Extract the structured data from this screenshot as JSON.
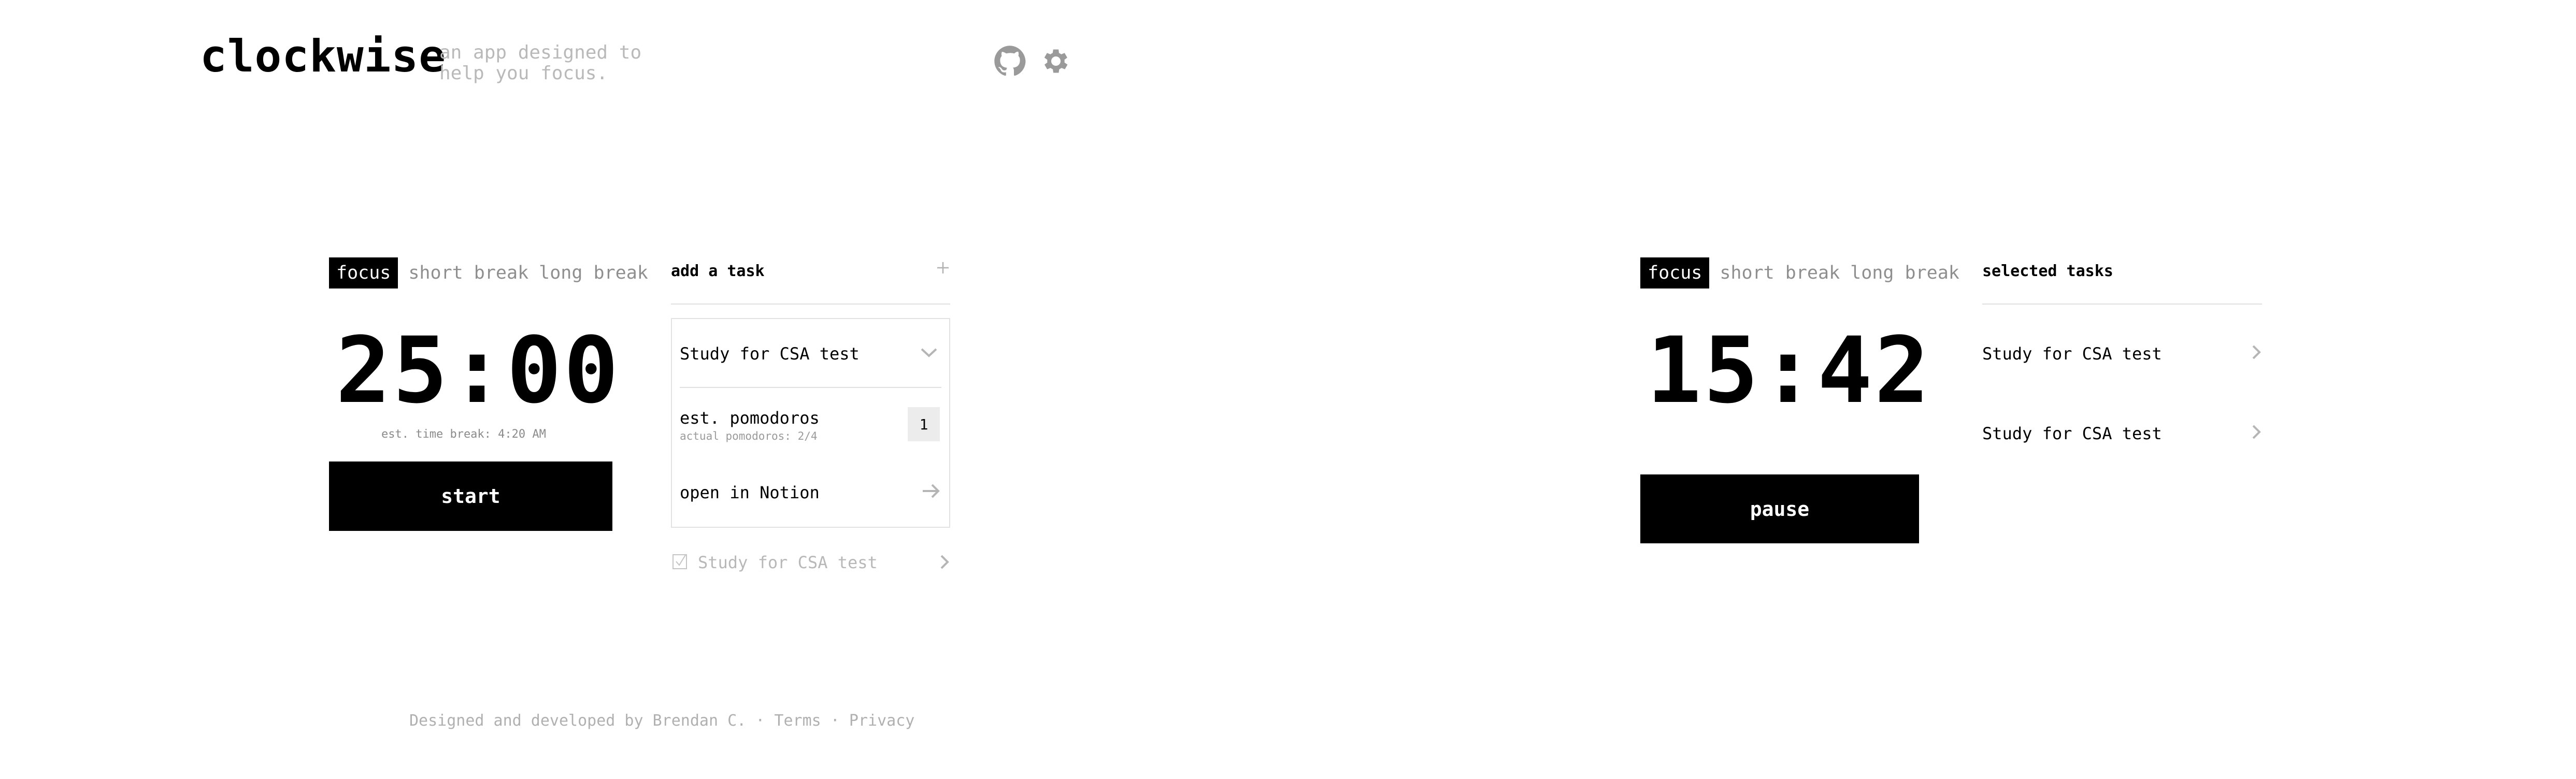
{
  "header": {
    "brand": "clockwise",
    "tagline": "an app designed to help you focus.",
    "github_icon": "github-icon",
    "settings_icon": "gear-icon"
  },
  "left": {
    "tabs": [
      "focus",
      "short break",
      "long break"
    ],
    "active_tab": "focus",
    "timer": "25:00",
    "est_break": "est. time break: 4:20 AM",
    "start_label": "start",
    "panel": {
      "title": "add a task",
      "add_icon": "plus-icon",
      "task_name": "Study for CSA test",
      "est_label": "est. pomodoros",
      "actual_label": "actual pomodoros: 2/4",
      "est_value": "1",
      "open_label": "open in Notion",
      "completed_task": "Study for CSA test"
    }
  },
  "right": {
    "tabs": [
      "focus",
      "short break",
      "long break"
    ],
    "active_tab": "focus",
    "timer": "15:42",
    "pause_label": "pause",
    "panel": {
      "title": "selected tasks",
      "tasks": [
        "Study for CSA test",
        "Study for CSA test"
      ]
    }
  },
  "footer": {
    "credit": "Designed and developed by Brendan C.",
    "sep1": "·",
    "terms": "Terms",
    "sep2": "·",
    "privacy": "Privacy"
  },
  "colors": {
    "accent": "#000000",
    "muted": "#b8b8b8",
    "border": "#e2e2e2"
  }
}
